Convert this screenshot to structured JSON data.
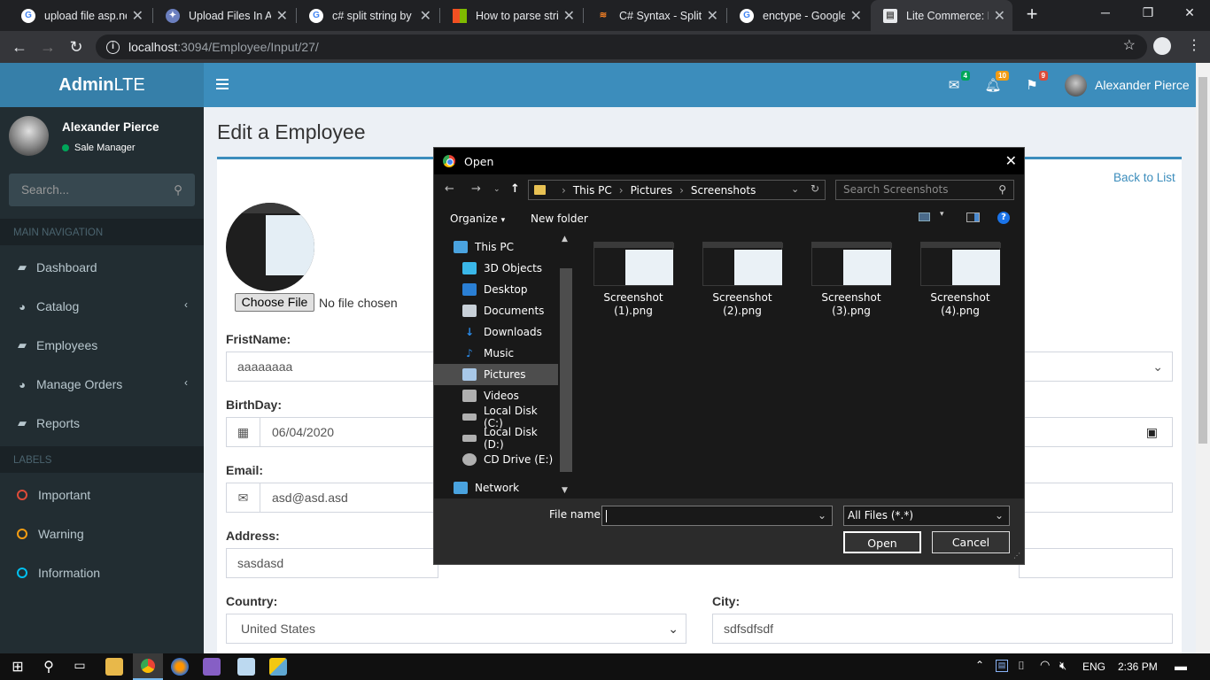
{
  "browser": {
    "tabs": [
      {
        "label": "upload file asp.ne",
        "icon": "google-icon"
      },
      {
        "label": "Upload Files In AS",
        "icon": "site-icon"
      },
      {
        "label": "c# split string by c",
        "icon": "google-icon"
      },
      {
        "label": "How to parse strin",
        "icon": "microsoft-icon"
      },
      {
        "label": "C# Syntax - Split S",
        "icon": "stack-icon"
      },
      {
        "label": "enctype - Google",
        "icon": "google-icon"
      },
      {
        "label": "Lite Commerce: Ed",
        "icon": "page-icon"
      }
    ],
    "url_host": "localhost",
    "url_path": ":3094/Employee/Input/27/"
  },
  "header": {
    "logo_bold": "Admin",
    "logo_light": "LTE",
    "badges": {
      "mail": "4",
      "bell": "10",
      "flag": "9"
    },
    "user_name": "Alexander Pierce"
  },
  "sidebar": {
    "user_name": "Alexander Pierce",
    "user_role": "Sale Manager",
    "search_placeholder": "Search...",
    "main_nav_header": "MAIN NAVIGATION",
    "items": [
      {
        "label": "Dashboard"
      },
      {
        "label": "Catalog"
      },
      {
        "label": "Employees"
      },
      {
        "label": "Manage Orders"
      },
      {
        "label": "Reports"
      }
    ],
    "labels_header": "LABELS",
    "labels": [
      {
        "label": "Important",
        "color": "#dd4b39"
      },
      {
        "label": "Warning",
        "color": "#f39c12"
      },
      {
        "label": "Information",
        "color": "#00c0ef"
      }
    ]
  },
  "content": {
    "page_title": "Edit a Employee",
    "back_link": "Back to List",
    "choose_file": "Choose File",
    "no_file": "No file chosen",
    "firstname_label": "FristName:",
    "firstname_value": "aaaaaaaa",
    "birthday_label": "BirthDay:",
    "birthday_value": "06/04/2020",
    "email_label": "Email:",
    "email_value": "asd@asd.asd",
    "address_label": "Address:",
    "address_value": "sasdasd",
    "country_label": "Country:",
    "country_value": "United States",
    "city_label": "City:",
    "city_value": "sdfsdfsdf"
  },
  "dialog": {
    "title": "Open",
    "path": [
      "This PC",
      "Pictures",
      "Screenshots"
    ],
    "search_placeholder": "Search Screenshots",
    "organize": "Organize",
    "new_folder": "New folder",
    "nav_items": [
      {
        "label": "This PC",
        "color": "#4aa3df"
      },
      {
        "label": "3D Objects",
        "color": "#3ab7e8"
      },
      {
        "label": "Desktop",
        "color": "#2a7fd4"
      },
      {
        "label": "Documents",
        "color": "#c8d0d8"
      },
      {
        "label": "Downloads",
        "color": "#2a8ae8"
      },
      {
        "label": "Music",
        "color": "#2a8ae8"
      },
      {
        "label": "Pictures",
        "color": "#a8c8e8"
      },
      {
        "label": "Videos",
        "color": "#b0b0b0"
      },
      {
        "label": "Local Disk (C:)",
        "color": "#b0b0b0"
      },
      {
        "label": "Local Disk (D:)",
        "color": "#b0b0b0"
      },
      {
        "label": "CD Drive (E:)",
        "color": "#b0b0b0"
      },
      {
        "label": "Network",
        "color": "#4aa3df"
      }
    ],
    "files": [
      {
        "name": "Screenshot (1).png"
      },
      {
        "name": "Screenshot (2).png"
      },
      {
        "name": "Screenshot (3).png"
      },
      {
        "name": "Screenshot (4).png"
      }
    ],
    "filename_label": "File name:",
    "filename_value": "",
    "filter": "All Files (*.*)",
    "open_btn": "Open",
    "cancel_btn": "Cancel"
  },
  "taskbar": {
    "lang": "ENG",
    "time": "2:36 PM"
  }
}
